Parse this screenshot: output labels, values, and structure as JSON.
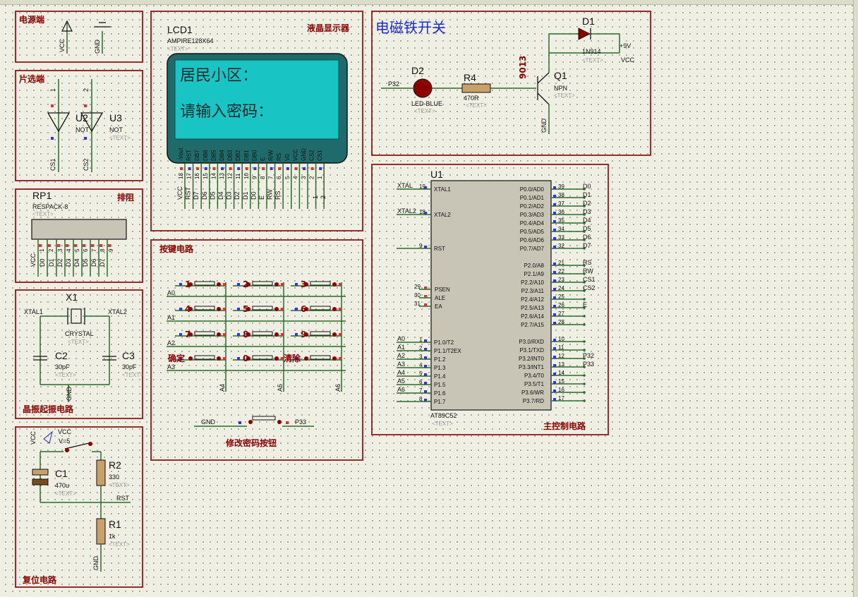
{
  "sections": {
    "power": "电源端",
    "chip_select": "片选端",
    "respack": "排阻",
    "crystal": "晶振起振电路",
    "reset": "复位电路",
    "lcd": "液晶显示器",
    "keys": "按键电路",
    "modify": "修改密码按钮",
    "magnet": "电磁铁开关",
    "main": "主控制电路"
  },
  "power": {
    "vcc": "VCC",
    "gnd": "GND"
  },
  "chip_select": {
    "u2": "U2",
    "u3": "U3",
    "not": "NOT",
    "not2": "NOT",
    "pin1": "1",
    "pin2": "2",
    "cs1": "CS1",
    "cs2": "CS2"
  },
  "respack": {
    "ref": "RP1",
    "value": "RESPACK-8",
    "vcc": "VCC",
    "pins": [
      "D0",
      "D1",
      "D2",
      "D3",
      "D4",
      "D5",
      "D6",
      "D7"
    ],
    "pnums": [
      "1",
      "2",
      "3",
      "4",
      "5",
      "6",
      "7",
      "8",
      "9"
    ]
  },
  "crystal": {
    "x1": "X1",
    "name": "CRYSTAL",
    "xtal1": "XTAL1",
    "xtal2": "XTAL2",
    "c2": "C2",
    "c3": "C3",
    "cval": "30pF",
    "cval2": "30pF",
    "gnd": "GND"
  },
  "reset": {
    "vcc": "VCC",
    "vcc2": "VCC",
    "v": "V=5",
    "c1": "C1",
    "c1val": "470u",
    "r2": "R2",
    "r2val": "330",
    "r1": "R1",
    "r1val": "1k",
    "rst": "RST",
    "gnd": "GND"
  },
  "lcd": {
    "ref": "LCD1",
    "model": "AMPIRE128X64",
    "line1": "居民小区：",
    "line2": "请输入密码：",
    "pin_names": [
      "-Vout",
      "RST",
      "DB7",
      "DB6",
      "DB5",
      "DB4",
      "DB3",
      "DB2",
      "DB1",
      "DB0",
      "E",
      "R/W",
      "RS",
      "V0",
      "VCC",
      "GND",
      "CS2",
      "CS1"
    ],
    "pin_nums": [
      "18",
      "17",
      "16",
      "15",
      "14",
      "13",
      "12",
      "11",
      "10",
      "9",
      "8",
      "7",
      "6",
      "5",
      "4",
      "3",
      "2",
      "1"
    ],
    "nets": [
      "VCC",
      "RST",
      "D7",
      "D6",
      "D5",
      "D4",
      "D3",
      "D2",
      "D1",
      "D0",
      "E",
      "RW",
      "RS",
      "",
      "",
      "",
      "",
      ""
    ]
  },
  "keys": {
    "labels": [
      "1",
      "2",
      "3",
      "4",
      "5",
      "6",
      "7",
      "8",
      "9",
      "确定",
      "0",
      "清除"
    ],
    "rows": [
      "A0",
      "A1",
      "A2",
      "A3"
    ],
    "cols": [
      "A4",
      "A5",
      "A6"
    ],
    "gnd": "GND",
    "p33": "P33"
  },
  "magnet": {
    "p32": "P32",
    "d2": "D2",
    "led": "LED-BLUE",
    "r4": "R4",
    "r4val": "470R",
    "q1": "Q1",
    "npn": "NPN",
    "n9013": "9013",
    "d1": "D1",
    "diode": "1N914",
    "plus9": "+9V",
    "vcc": "VCC",
    "gnd": "GND"
  },
  "mcu": {
    "ref": "U1",
    "model": "AT89C52",
    "left_top": [
      {
        "net": "XTAL",
        "num": "19",
        "name": "XTAL1"
      },
      {
        "net": "XTAL2",
        "num": "18",
        "name": "XTAL2"
      },
      {
        "net": "",
        "num": "9",
        "name": "RST"
      }
    ],
    "left_mid": [
      {
        "num": "29",
        "name": "PSEN"
      },
      {
        "num": "30",
        "name": "ALE"
      },
      {
        "num": "31",
        "name": "EA"
      }
    ],
    "left_bot": [
      {
        "net": "A0",
        "num": "1",
        "name": "P1.0/T2"
      },
      {
        "net": "A1",
        "num": "2",
        "name": "P1.1/T2EX"
      },
      {
        "net": "A2",
        "num": "3",
        "name": "P1.2"
      },
      {
        "net": "A3",
        "num": "4",
        "name": "P1.3"
      },
      {
        "net": "A4",
        "num": "5",
        "name": "P1.4"
      },
      {
        "net": "A5",
        "num": "6",
        "name": "P1.5"
      },
      {
        "net": "A6",
        "num": "7",
        "name": "P1.6"
      },
      {
        "net": "",
        "num": "8",
        "name": "P1.7"
      }
    ],
    "right_top": [
      {
        "name": "P0.0/AD0",
        "num": "39",
        "net": "D0"
      },
      {
        "name": "P0.1/AD1",
        "num": "38",
        "net": "D1"
      },
      {
        "name": "P0.2/AD2",
        "num": "37",
        "net": "D2"
      },
      {
        "name": "P0.3/AD3",
        "num": "36",
        "net": "D3"
      },
      {
        "name": "P0.4/AD4",
        "num": "35",
        "net": "D4"
      },
      {
        "name": "P0.5/AD5",
        "num": "34",
        "net": "D5"
      },
      {
        "name": "P0.6/AD6",
        "num": "33",
        "net": "D6"
      },
      {
        "name": "P0.7/AD7",
        "num": "32",
        "net": "D7"
      }
    ],
    "right_mid": [
      {
        "name": "P2.0/A8",
        "num": "21",
        "net": "RS"
      },
      {
        "name": "P2.1/A9",
        "num": "22",
        "net": "RW"
      },
      {
        "name": "P2.2/A10",
        "num": "23",
        "net": "CS1"
      },
      {
        "name": "P2.3/A11",
        "num": "24",
        "net": "CS2"
      },
      {
        "name": "P2.4/A12",
        "num": "25",
        "net": ""
      },
      {
        "name": "P2.5/A13",
        "num": "26",
        "net": "E"
      },
      {
        "name": "P2.6/A14",
        "num": "27",
        "net": ""
      },
      {
        "name": "P2.7/A15",
        "num": "28",
        "net": ""
      }
    ],
    "right_bot": [
      {
        "name": "P3.0/RXD",
        "num": "10",
        "net": ""
      },
      {
        "name": "P3.1/TXD",
        "num": "11",
        "net": ""
      },
      {
        "name": "P3.2/INT0",
        "num": "12",
        "net": "P32"
      },
      {
        "name": "P3.3/INT1",
        "num": "13",
        "net": "P33"
      },
      {
        "name": "P3.4/T0",
        "num": "14",
        "net": ""
      },
      {
        "name": "P3.5/T1",
        "num": "15",
        "net": ""
      },
      {
        "name": "P3.6/WR",
        "num": "16",
        "net": ""
      },
      {
        "name": "P3.7/RD",
        "num": "17",
        "net": ""
      }
    ]
  },
  "text_placeholder": "<TEXT>"
}
